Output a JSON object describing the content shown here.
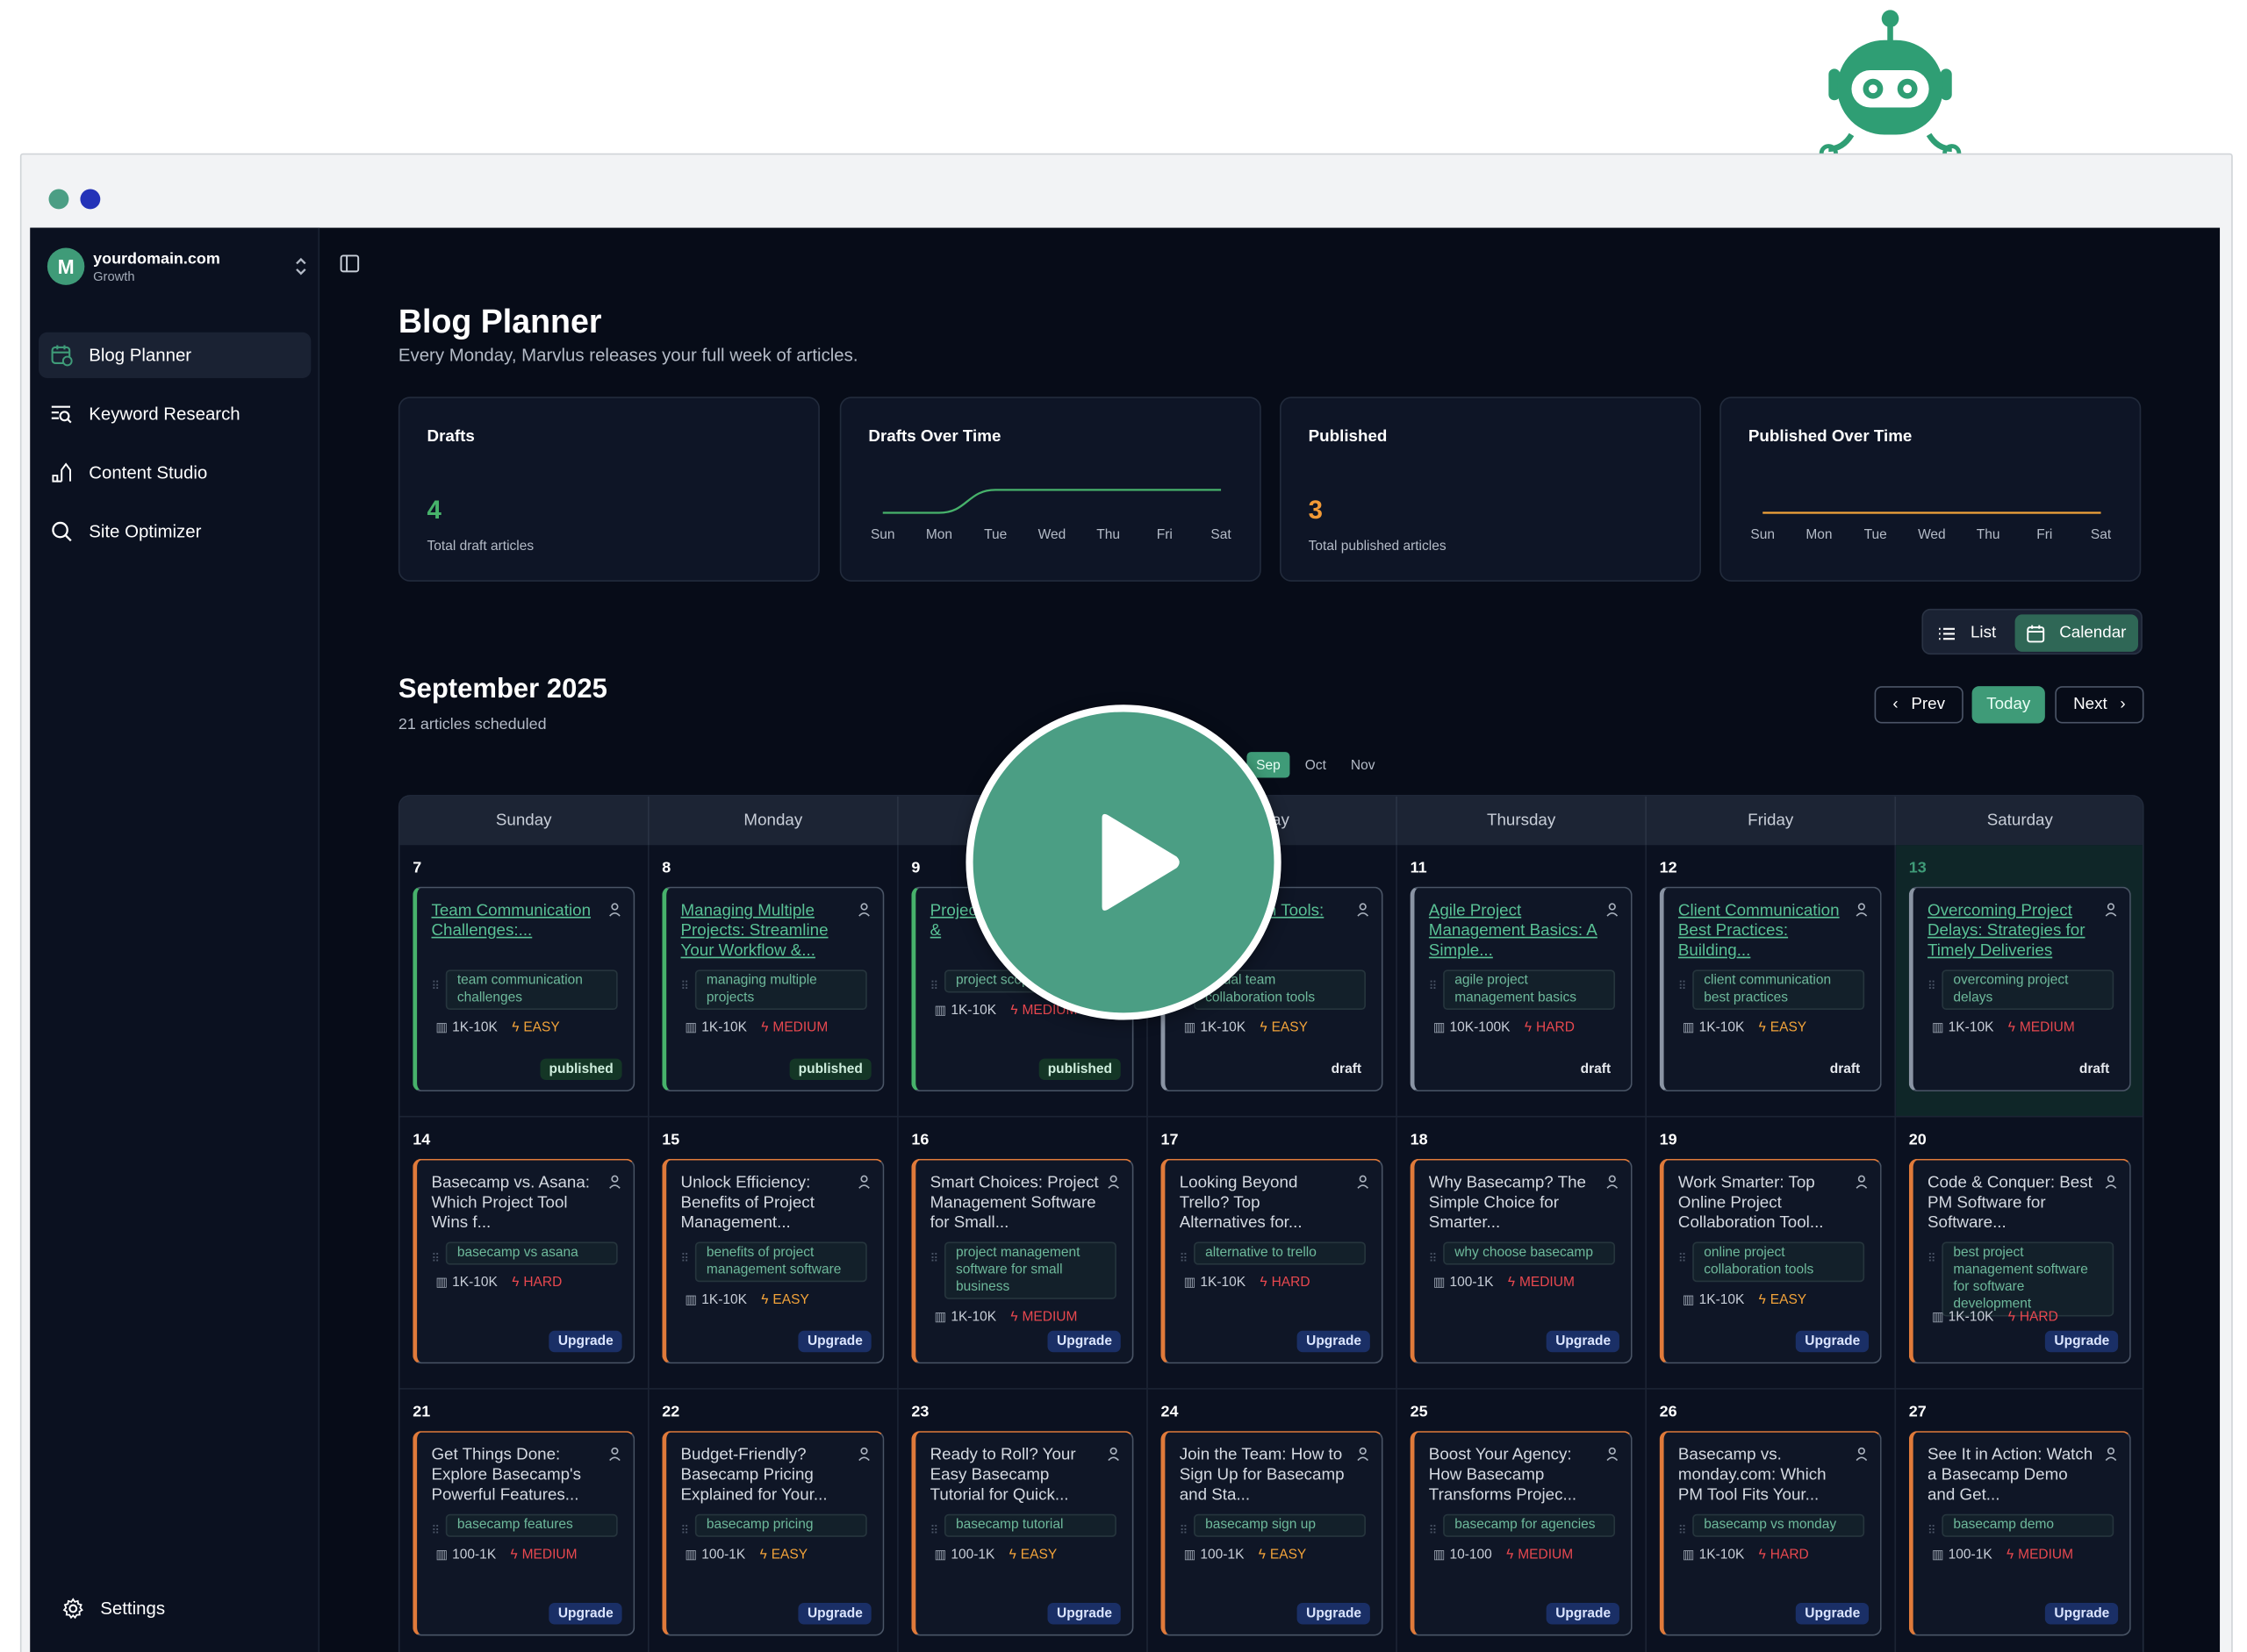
{
  "app": {
    "workspace": {
      "domain": "yourdomain.com",
      "plan": "Growth",
      "logo_letter": "M"
    },
    "nav": [
      {
        "label": "Blog Planner",
        "icon": "calendar-icon",
        "active": true
      },
      {
        "label": "Keyword Research",
        "icon": "keyword-search-icon",
        "active": false
      },
      {
        "label": "Content Studio",
        "icon": "pen-icon",
        "active": false
      },
      {
        "label": "Site Optimizer",
        "icon": "search-icon",
        "active": false
      }
    ],
    "settings_label": "Settings"
  },
  "page": {
    "title": "Blog Planner",
    "subtitle": "Every Monday, Marvlus releases your full week of articles."
  },
  "stats": {
    "drafts": {
      "label": "Drafts",
      "value": "4",
      "desc": "Total draft articles",
      "color": "#47b26b"
    },
    "drafts_over_time": {
      "label": "Drafts Over Time",
      "days": [
        "Sun",
        "Mon",
        "Tue",
        "Wed",
        "Thu",
        "Fri",
        "Sat"
      ],
      "values": [
        0,
        0,
        1,
        1,
        1,
        1,
        1
      ],
      "color": "#47b26b"
    },
    "published": {
      "label": "Published",
      "value": "3",
      "desc": "Total published articles",
      "color": "#f29a36"
    },
    "published_over_time": {
      "label": "Published Over Time",
      "days": [
        "Sun",
        "Mon",
        "Tue",
        "Wed",
        "Thu",
        "Fri",
        "Sat"
      ],
      "values": [
        0,
        0,
        0,
        0,
        0,
        0,
        0
      ],
      "color": "#f2a33a"
    }
  },
  "view_toggle": {
    "list_label": "List",
    "calendar_label": "Calendar",
    "active": "Calendar"
  },
  "calendar": {
    "month_title": "September 2025",
    "count_label": "21 articles scheduled",
    "prev_label": "Prev",
    "today_label": "Today",
    "next_label": "Next",
    "months": [
      "Sep",
      "Oct",
      "Nov"
    ],
    "active_month": "Sep",
    "weekdays": [
      "Sunday",
      "Monday",
      "Tuesday",
      "Wednesday",
      "Thursday",
      "Friday",
      "Saturday"
    ],
    "header_visible": [
      "Sunday",
      "Monday",
      "",
      "sday",
      "Thursday",
      "Friday",
      "Saturday"
    ],
    "today_day": "13",
    "colors": {
      "easy": "#f2a33a",
      "medium": "#e8484f",
      "hard": "#e8484f"
    },
    "weeks": [
      [
        {
          "day": "7",
          "title": "Team Communication Challenges:...",
          "keyword": "team communication challenges",
          "volume": "1K-10K",
          "difficulty": "EASY",
          "status": "published"
        },
        {
          "day": "8",
          "title": "Managing Multiple Projects: Streamline Your Workflow &...",
          "keyword": "managing multiple projects",
          "volume": "1K-10K",
          "difficulty": "MEDIUM",
          "status": "published"
        },
        {
          "day": "9",
          "title": "Project Creep: Control &",
          "keyword": "project scope",
          "volume": "1K-10K",
          "difficulty": "MEDIUM",
          "status": "published"
        },
        {
          "day": "10",
          "title": "Collaboration Tools: Remote...",
          "keyword": "virtual team collaboration tools",
          "volume": "1K-10K",
          "difficulty": "EASY",
          "status": "draft"
        },
        {
          "day": "11",
          "title": "Agile Project Management Basics: A Simple...",
          "keyword": "agile project management basics",
          "volume": "10K-100K",
          "difficulty": "HARD",
          "status": "draft"
        },
        {
          "day": "12",
          "title": "Client Communication Best Practices: Building...",
          "keyword": "client communication best practices",
          "volume": "1K-10K",
          "difficulty": "EASY",
          "status": "draft"
        },
        {
          "day": "13",
          "title": "Overcoming Project Delays: Strategies for Timely Deliveries",
          "keyword": "overcoming project delays",
          "volume": "1K-10K",
          "difficulty": "MEDIUM",
          "status": "draft"
        }
      ],
      [
        {
          "day": "14",
          "title": "Basecamp vs. Asana: Which Project Tool Wins f...",
          "keyword": "basecamp vs asana",
          "volume": "1K-10K",
          "difficulty": "HARD",
          "status": "Upgrade"
        },
        {
          "day": "15",
          "title": "Unlock Efficiency: Benefits of Project Management...",
          "keyword": "benefits of project management software",
          "volume": "1K-10K",
          "difficulty": "EASY",
          "status": "Upgrade"
        },
        {
          "day": "16",
          "title": "Smart Choices: Project Management Software for Small...",
          "keyword": "project management software for small business",
          "volume": "1K-10K",
          "difficulty": "MEDIUM",
          "status": "Upgrade"
        },
        {
          "day": "17",
          "title": "Looking Beyond Trello? Top Alternatives for...",
          "keyword": "alternative to trello",
          "volume": "1K-10K",
          "difficulty": "HARD",
          "status": "Upgrade"
        },
        {
          "day": "18",
          "title": "Why Basecamp? The Simple Choice for Smarter...",
          "keyword": "why choose basecamp",
          "volume": "100-1K",
          "difficulty": "MEDIUM",
          "status": "Upgrade"
        },
        {
          "day": "19",
          "title": "Work Smarter: Top Online Project Collaboration Tool...",
          "keyword": "online project collaboration tools",
          "volume": "1K-10K",
          "difficulty": "EASY",
          "status": "Upgrade"
        },
        {
          "day": "20",
          "title": "Code & Conquer: Best PM Software for Software...",
          "keyword": "best project management software for software development",
          "volume": "1K-10K",
          "difficulty": "HARD",
          "status": "Upgrade"
        }
      ],
      [
        {
          "day": "21",
          "title": "Get Things Done: Explore Basecamp's Powerful Features...",
          "keyword": "basecamp features",
          "volume": "100-1K",
          "difficulty": "MEDIUM",
          "status": "Upgrade"
        },
        {
          "day": "22",
          "title": "Budget-Friendly? Basecamp Pricing Explained for Your...",
          "keyword": "basecamp pricing",
          "volume": "100-1K",
          "difficulty": "EASY",
          "status": "Upgrade"
        },
        {
          "day": "23",
          "title": "Ready to Roll? Your Easy Basecamp Tutorial for Quick...",
          "keyword": "basecamp tutorial",
          "volume": "100-1K",
          "difficulty": "EASY",
          "status": "Upgrade"
        },
        {
          "day": "24",
          "title": "Join the Team: How to Sign Up for Basecamp and Sta...",
          "keyword": "basecamp sign up",
          "volume": "100-1K",
          "difficulty": "EASY",
          "status": "Upgrade"
        },
        {
          "day": "25",
          "title": "Boost Your Agency: How Basecamp Transforms Projec...",
          "keyword": "basecamp for agencies",
          "volume": "10-100",
          "difficulty": "MEDIUM",
          "status": "Upgrade"
        },
        {
          "day": "26",
          "title": "Basecamp vs. monday.com: Which PM Tool Fits Your...",
          "keyword": "basecamp vs monday",
          "volume": "1K-10K",
          "difficulty": "HARD",
          "status": "Upgrade"
        },
        {
          "day": "27",
          "title": "See It in Action: Watch a Basecamp Demo and Get...",
          "keyword": "basecamp demo",
          "volume": "100-1K",
          "difficulty": "MEDIUM",
          "status": "Upgrade"
        }
      ]
    ]
  },
  "overlay": {
    "icon": "play-icon"
  }
}
